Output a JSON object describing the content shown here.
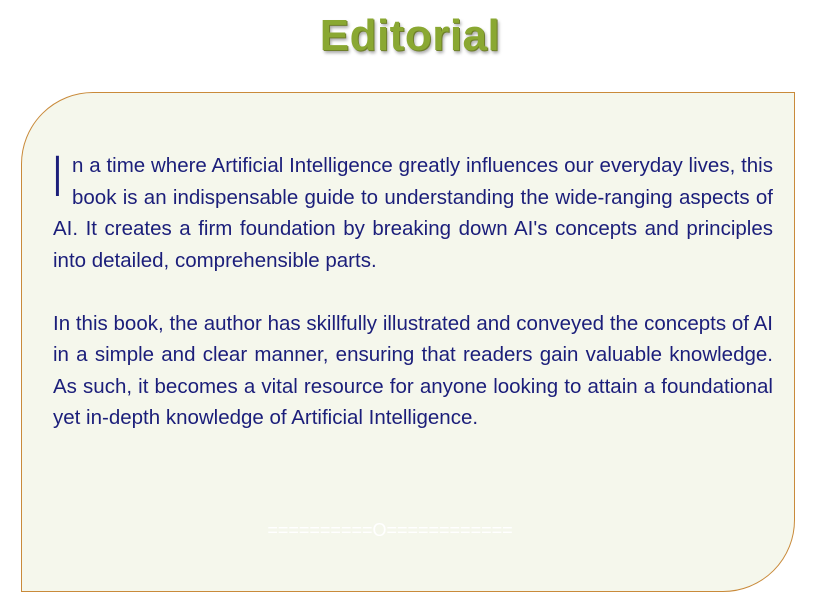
{
  "title": "Editorial",
  "paragraphs": {
    "p1_dropcap": "I",
    "p1_rest": "n a time where Artificial Intelligence greatly influences our everyday lives, this book is an indispensable guide to understanding the wide-ranging aspects of AI. It creates a firm foundation by breaking down AI's concepts and principles into detailed, comprehensible parts.",
    "p2": "In this book, the author has skillfully illustrated and conveyed the concepts of AI in a simple and clear manner, ensuring that readers gain valuable knowledge. As such, it becomes a vital resource for anyone looking to attain a foundational yet in-depth knowledge of Artificial Intelligence."
  },
  "divider": "==========O============",
  "colors": {
    "title": "#8aa832",
    "text": "#1b1e7a",
    "card_background": "#f5f7ec",
    "card_border": "#c98a3a"
  }
}
